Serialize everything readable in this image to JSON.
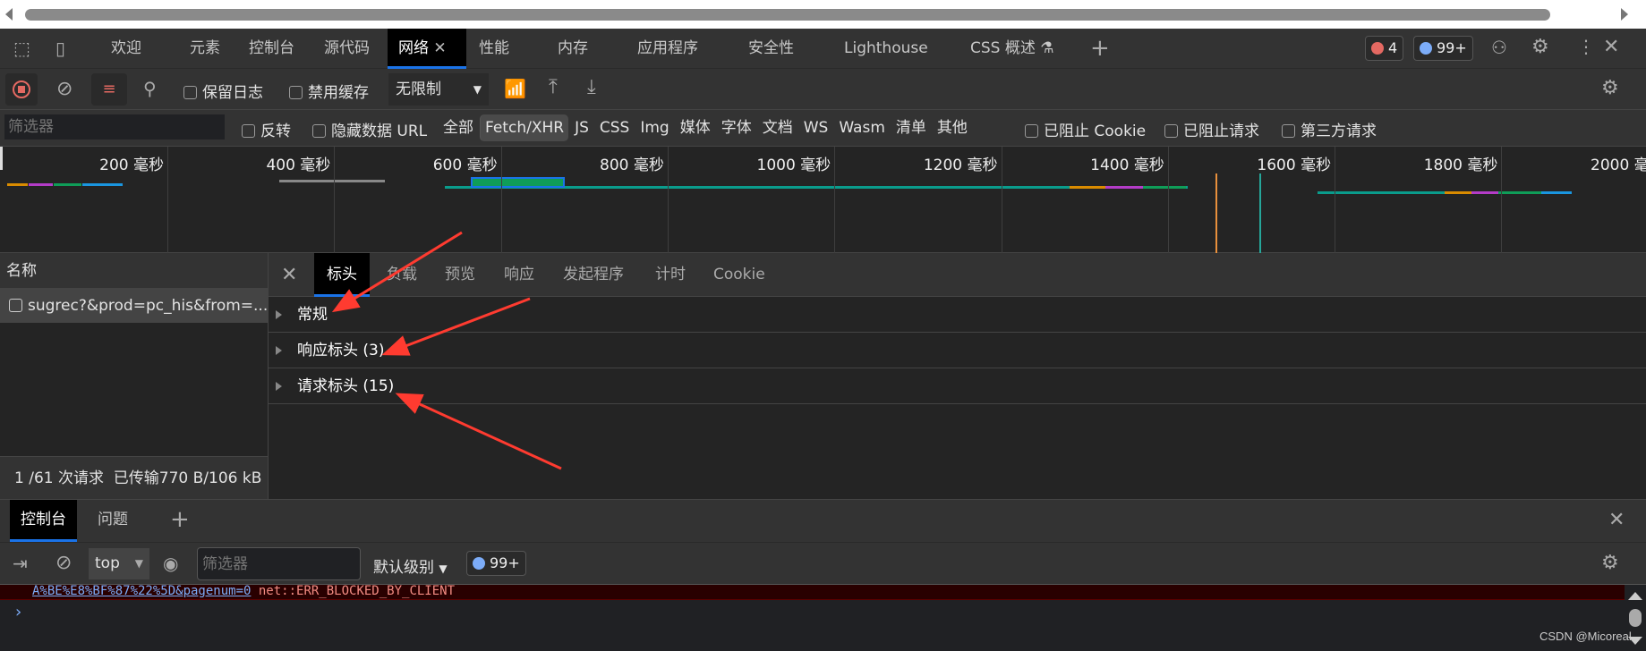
{
  "tabs": [
    {
      "label": "欢迎"
    },
    {
      "label": "元素"
    },
    {
      "label": "控制台"
    },
    {
      "label": "源代码"
    },
    {
      "label": "网络",
      "active": true
    },
    {
      "label": "性能"
    },
    {
      "label": "内存"
    },
    {
      "label": "应用程序"
    },
    {
      "label": "安全性"
    },
    {
      "label": "Lighthouse"
    },
    {
      "label": "CSS 概述"
    }
  ],
  "badges": {
    "errors": "4",
    "messages": "99+"
  },
  "toolbar": {
    "preserve_log": "保留日志",
    "disable_cache": "禁用缓存",
    "throttle": "无限制"
  },
  "filter": {
    "placeholder": "筛选器",
    "invert": "反转",
    "hide_data_url": "隐藏数据 URL",
    "types": [
      "全部",
      "Fetch/XHR",
      "JS",
      "CSS",
      "Img",
      "媒体",
      "字体",
      "文档",
      "WS",
      "Wasm",
      "清单",
      "其他"
    ],
    "active_type": "Fetch/XHR",
    "blocked_cookies": "已阻止 Cookie",
    "blocked_requests": "已阻止请求",
    "third_party": "第三方请求"
  },
  "timeline": {
    "ticks": [
      "200 毫秒",
      "400 毫秒",
      "600 毫秒",
      "800 毫秒",
      "1000 毫秒",
      "1200 毫秒",
      "1400 毫秒",
      "1600 毫秒",
      "1800 毫秒",
      "2000 毫秒"
    ]
  },
  "requests": {
    "header": "名称",
    "rows": [
      {
        "name": "sugrec?&prod=pc_his&from=..."
      }
    ],
    "summary": "1 /61 次请求  已传输770 B/106 kB"
  },
  "detail": {
    "tabs": [
      "标头",
      "负载",
      "预览",
      "响应",
      "发起程序",
      "计时",
      "Cookie"
    ],
    "sections": [
      "常规",
      "响应标头 (3)",
      "请求标头 (15)"
    ]
  },
  "drawer": {
    "tabs": [
      "控制台",
      "问题"
    ],
    "context": "top",
    "filter_placeholder": "筛选器",
    "level": "默认级别",
    "messages": "99+"
  },
  "console": {
    "error_url": "A%BE%E8%BF%87%22%5D&pagenum=0",
    "error_text": "net::ERR_BLOCKED_BY_CLIENT"
  },
  "watermark": "CSDN @Micoreal",
  "colors": {
    "accent": "#1a73e8",
    "error": "#e46962",
    "message": "#7cacf8",
    "annotation": "#ff3b30"
  }
}
